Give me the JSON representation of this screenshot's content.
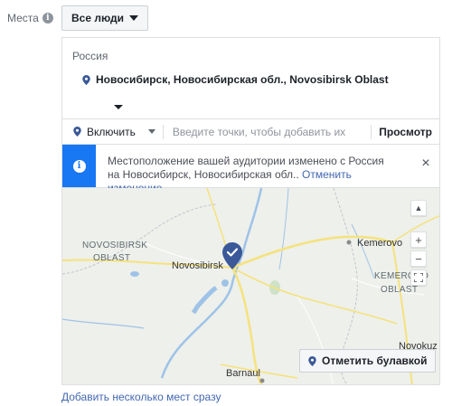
{
  "field": {
    "label": "Места",
    "info_icon": "i"
  },
  "audience_dropdown": {
    "label": "Все люди"
  },
  "locations": {
    "country": "Россия",
    "selected": "Новосибирск, Новосибирская обл., Novosibirsk Oblast"
  },
  "search": {
    "include_label": "Включить",
    "placeholder": "Введите точки, чтобы добавить их",
    "preview_label": "Просмотр"
  },
  "notice": {
    "icon": "i",
    "text": "Местоположение вашей аудитории изменено с Россия на Новосибирск, Новосибирская обл..",
    "undo_link": "Отменить изменение",
    "close": "×"
  },
  "map": {
    "region_label_1": "NOVOSIBIRSK",
    "region_label_2": "OBLAST",
    "region_label_3": "KEMEROVO",
    "region_label_4": "OBLAST",
    "city_novosibirsk": "Novosibirsk",
    "city_kemerovo": "Kemerovo",
    "city_barnaul": "Barnaul",
    "city_novokuz": "Novokuz",
    "zoom_in": "+",
    "zoom_out": "−",
    "pin_button_label": "Отметить булавкой",
    "accent_color": "#1877f2",
    "pin_color": "#3b5998"
  },
  "footer": {
    "add_multiple_link": "Добавить несколько мест сразу"
  }
}
